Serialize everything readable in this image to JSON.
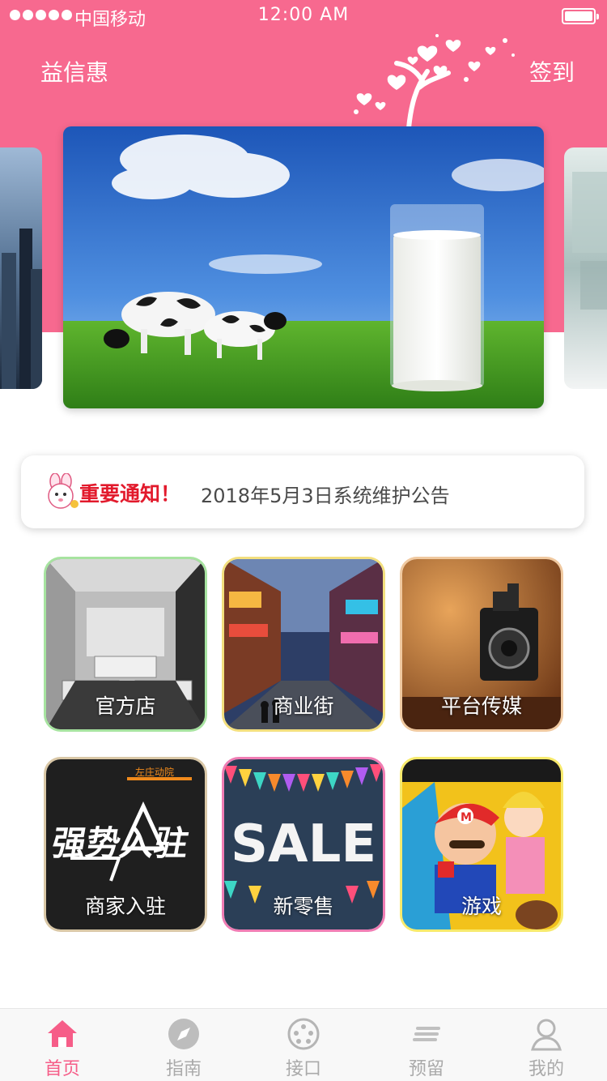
{
  "status_bar": {
    "carrier": "中国移动",
    "time": "12:00 AM"
  },
  "header": {
    "title": "益信惠",
    "checkin_label": "签到"
  },
  "carousel": {
    "banner_icon": "milk-cows-banner-image",
    "left_peek_icon": "city-skyline-image",
    "right_peek_icon": "partial-banner-image"
  },
  "notice": {
    "tag": "重要通知！",
    "text": "2018年5月3日系统维护公告",
    "mascot_icon": "rabbit-mascot-icon"
  },
  "grid": [
    {
      "label": "官方店",
      "icon": "showroom-image"
    },
    {
      "label": "商业街",
      "icon": "shopping-street-image"
    },
    {
      "label": "平台传媒",
      "icon": "vintage-camera-image"
    },
    {
      "label": "商家入驻",
      "icon": "merchant-join-image",
      "art_text": "强势入驻"
    },
    {
      "label": "新零售",
      "icon": "sale-bunting-image",
      "art_text": "SALE"
    },
    {
      "label": "游戏",
      "icon": "game-mario-image"
    }
  ],
  "tabs": [
    {
      "label": "首页",
      "icon": "home-icon",
      "active": true
    },
    {
      "label": "指南",
      "icon": "compass-icon",
      "active": false
    },
    {
      "label": "接口",
      "icon": "port-icon",
      "active": false
    },
    {
      "label": "预留",
      "icon": "lines-icon",
      "active": false
    },
    {
      "label": "我的",
      "icon": "user-icon",
      "active": false
    }
  ],
  "colors": {
    "brand_pink": "#f7698f",
    "active_tab": "#f65d88",
    "inactive_tab": "#aaaaaa",
    "notice_tag": "#e21a2c"
  }
}
